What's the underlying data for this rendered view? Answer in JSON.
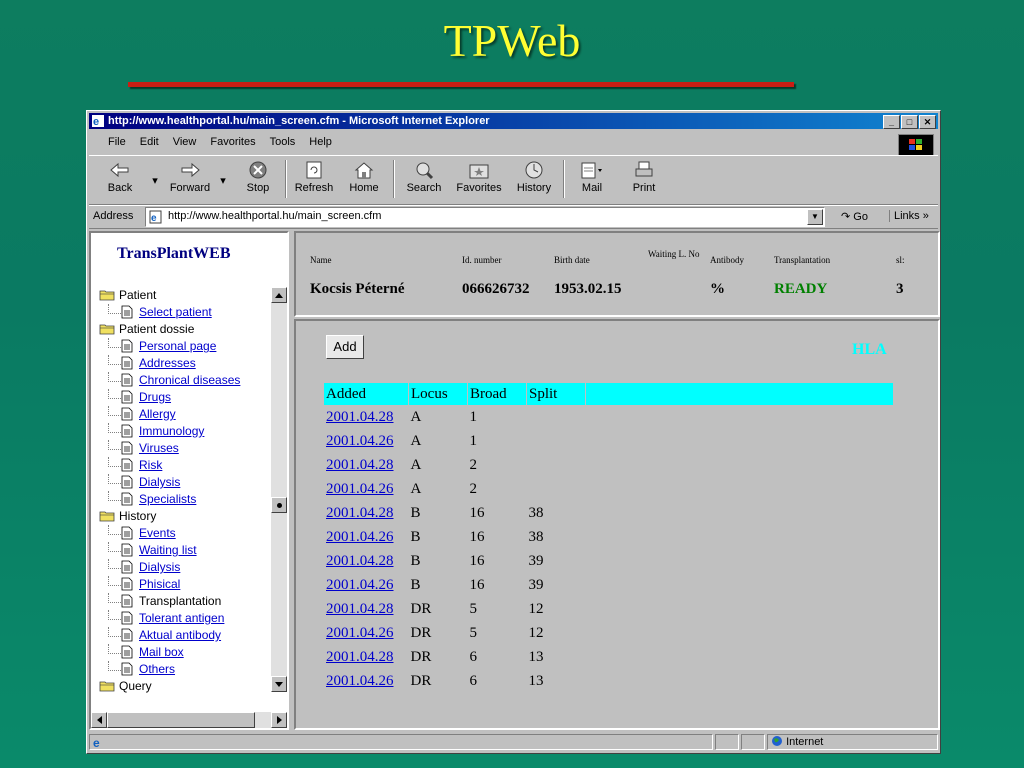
{
  "slide": {
    "title": "TPWeb"
  },
  "window": {
    "title": "http://www.healthportal.hu/main_screen.cfm - Microsoft Internet Explorer",
    "controls": [
      "_",
      "□",
      "✕"
    ]
  },
  "menu": [
    "File",
    "Edit",
    "View",
    "Favorites",
    "Tools",
    "Help"
  ],
  "toolbar": [
    {
      "label": "Back",
      "icon": "back-arrow-icon"
    },
    {
      "label": "Forward",
      "icon": "forward-arrow-icon"
    },
    {
      "label": "Stop",
      "icon": "stop-icon"
    },
    {
      "label": "Refresh",
      "icon": "refresh-icon"
    },
    {
      "label": "Home",
      "icon": "home-icon"
    },
    {
      "label": "Search",
      "icon": "search-icon"
    },
    {
      "label": "Favorites",
      "icon": "favorites-icon"
    },
    {
      "label": "History",
      "icon": "history-icon"
    },
    {
      "label": "Mail",
      "icon": "mail-icon"
    },
    {
      "label": "Print",
      "icon": "print-icon"
    }
  ],
  "address": {
    "label": "Address",
    "url": "http://www.healthportal.hu/main_screen.cfm",
    "go": "Go",
    "links": "Links »"
  },
  "sidebar": {
    "title": "TransPlantWEB",
    "tree": [
      {
        "type": "folder",
        "label": "Patient"
      },
      {
        "type": "link",
        "label": "Select patient"
      },
      {
        "type": "folder",
        "label": "Patient dossie"
      },
      {
        "type": "link",
        "label": "Personal page"
      },
      {
        "type": "link",
        "label": "Addresses"
      },
      {
        "type": "link",
        "label": "Chronical diseases"
      },
      {
        "type": "link",
        "label": "Drugs"
      },
      {
        "type": "link",
        "label": "Allergy"
      },
      {
        "type": "link",
        "label": "Immunology"
      },
      {
        "type": "link",
        "label": "Viruses"
      },
      {
        "type": "link",
        "label": "Risk"
      },
      {
        "type": "link",
        "label": "Dialysis"
      },
      {
        "type": "link",
        "label": "Specialists"
      },
      {
        "type": "folder",
        "label": "History"
      },
      {
        "type": "link",
        "label": "Events"
      },
      {
        "type": "link",
        "label": "Waiting list"
      },
      {
        "type": "link",
        "label": "Dialysis"
      },
      {
        "type": "link",
        "label": "Phisical"
      },
      {
        "type": "text",
        "label": "Transplantation"
      },
      {
        "type": "link",
        "label": "Tolerant antigen"
      },
      {
        "type": "link",
        "label": "Aktual antibody"
      },
      {
        "type": "link",
        "label": "Mail box"
      },
      {
        "type": "link",
        "label": "Others"
      },
      {
        "type": "folder",
        "label": "Query"
      }
    ]
  },
  "patient": {
    "headers": {
      "name": "Name",
      "id": "Id. number",
      "birth": "Birth date",
      "waiting": "Waiting L. No",
      "antibody": "Antibody",
      "transplantation": "Transplantation",
      "sl": "sl:"
    },
    "values": {
      "name": "Kocsis Péterné",
      "id": "066626732",
      "birth": "1953.02.15",
      "waiting": "",
      "antibody": "%",
      "transplantation": "READY",
      "sl": "3"
    },
    "ready_color": "#008000"
  },
  "main": {
    "add_label": "Add",
    "section_label": "HLA",
    "columns": [
      "Added",
      "Locus",
      "Broad",
      "Split"
    ],
    "rows": [
      {
        "added": "2001.04.28",
        "locus": "A",
        "broad": "1",
        "split": ""
      },
      {
        "added": "2001.04.26",
        "locus": "A",
        "broad": "1",
        "split": ""
      },
      {
        "added": "2001.04.28",
        "locus": "A",
        "broad": "2",
        "split": ""
      },
      {
        "added": "2001.04.26",
        "locus": "A",
        "broad": "2",
        "split": ""
      },
      {
        "added": "2001.04.28",
        "locus": "B",
        "broad": "16",
        "split": "38"
      },
      {
        "added": "2001.04.26",
        "locus": "B",
        "broad": "16",
        "split": "38"
      },
      {
        "added": "2001.04.28",
        "locus": "B",
        "broad": "16",
        "split": "39"
      },
      {
        "added": "2001.04.26",
        "locus": "B",
        "broad": "16",
        "split": "39"
      },
      {
        "added": "2001.04.28",
        "locus": "DR",
        "broad": "5",
        "split": "12"
      },
      {
        "added": "2001.04.26",
        "locus": "DR",
        "broad": "5",
        "split": "12"
      },
      {
        "added": "2001.04.28",
        "locus": "DR",
        "broad": "6",
        "split": "13"
      },
      {
        "added": "2001.04.26",
        "locus": "DR",
        "broad": "6",
        "split": "13"
      }
    ]
  },
  "status": {
    "zone": "Internet"
  }
}
